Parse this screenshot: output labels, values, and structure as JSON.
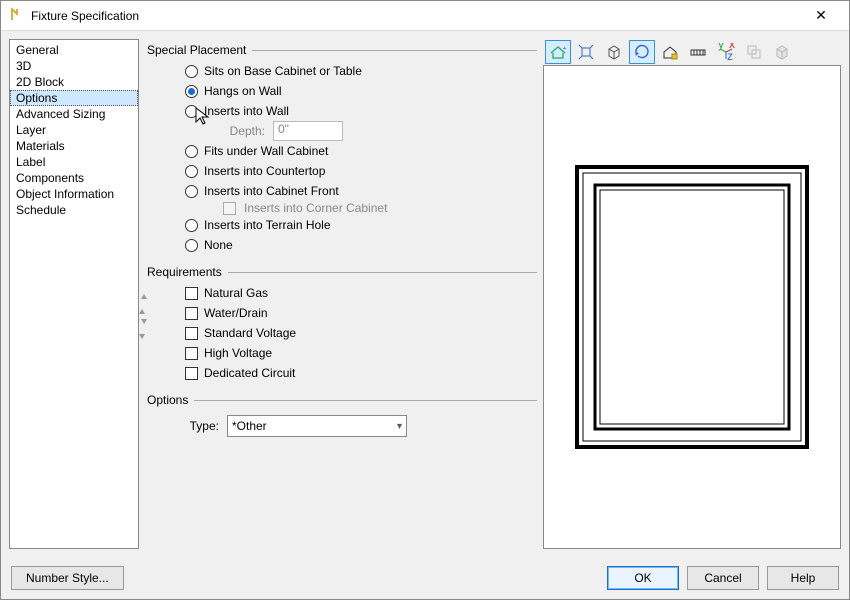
{
  "window": {
    "title": "Fixture Specification"
  },
  "sidebar": {
    "items": [
      {
        "label": "General"
      },
      {
        "label": "3D"
      },
      {
        "label": "2D Block"
      },
      {
        "label": "Options"
      },
      {
        "label": "Advanced Sizing"
      },
      {
        "label": "Layer"
      },
      {
        "label": "Materials"
      },
      {
        "label": "Label"
      },
      {
        "label": "Components"
      },
      {
        "label": "Object Information"
      },
      {
        "label": "Schedule"
      }
    ],
    "selected_index": 3
  },
  "special_placement": {
    "legend": "Special Placement",
    "options": [
      {
        "label": "Sits on Base Cabinet or Table"
      },
      {
        "label": "Hangs on Wall"
      },
      {
        "label": "Inserts into Wall"
      },
      {
        "label": "Fits under Wall Cabinet"
      },
      {
        "label": "Inserts into Countertop"
      },
      {
        "label": "Inserts into Cabinet Front"
      },
      {
        "label": "Inserts into Terrain Hole"
      },
      {
        "label": "None"
      }
    ],
    "selected_index": 1,
    "depth": {
      "label": "Depth:",
      "value": "0\""
    },
    "corner_cabinet": {
      "label": "Inserts into Corner Cabinet"
    }
  },
  "requirements": {
    "legend": "Requirements",
    "items": [
      {
        "label": "Natural Gas"
      },
      {
        "label": "Water/Drain"
      },
      {
        "label": "Standard Voltage"
      },
      {
        "label": "High Voltage"
      },
      {
        "label": "Dedicated Circuit"
      }
    ]
  },
  "options_section": {
    "legend": "Options",
    "type_label": "Type:",
    "type_value": "*Other"
  },
  "toolbar_icons": [
    "elevation-view",
    "full-extent",
    "cube-view",
    "rotate-cam",
    "house-color",
    "measure",
    "xyz-axes",
    "copy-view",
    "cube-shaded"
  ],
  "footer": {
    "number_style": "Number Style...",
    "ok": "OK",
    "cancel": "Cancel",
    "help": "Help"
  }
}
